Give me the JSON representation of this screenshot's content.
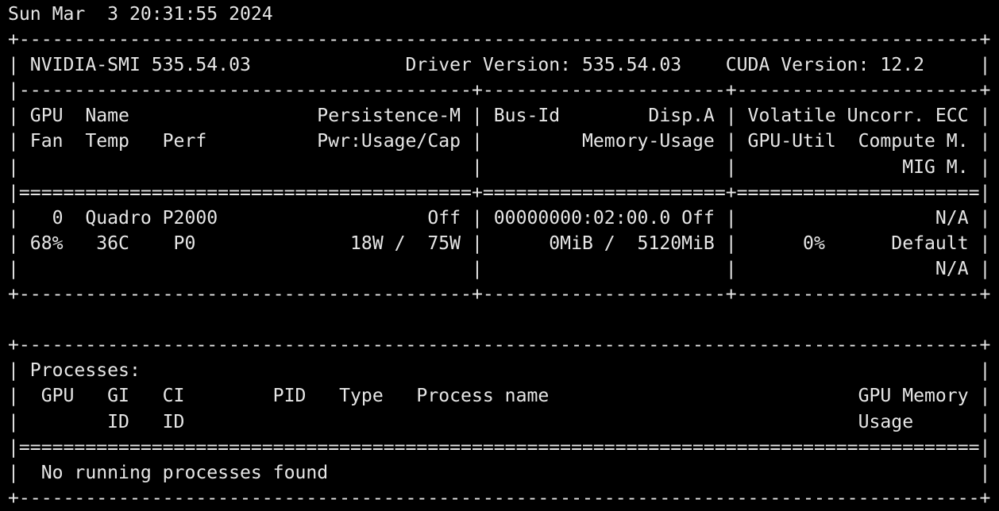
{
  "terminal": {
    "lines": [
      "Sun Mar  3 20:31:55 2024",
      "+---------------------------------------------------------------------------------------+",
      "| NVIDIA-SMI 535.54.03              Driver Version: 535.54.03    CUDA Version: 12.2     |",
      "|-----------------------------------------+----------------------+----------------------+",
      "| GPU  Name                 Persistence-M | Bus-Id        Disp.A | Volatile Uncorr. ECC |",
      "| Fan  Temp   Perf          Pwr:Usage/Cap |         Memory-Usage | GPU-Util  Compute M. |",
      "|                                         |                      |               MIG M. |",
      "|=========================================+======================+======================|",
      "|   0  Quadro P2000                   Off | 00000000:02:00.0 Off |                  N/A |",
      "| 68%   36C    P0              18W /  75W |      0MiB /  5120MiB |      0%      Default |",
      "|                                         |                      |                  N/A |",
      "+-----------------------------------------+----------------------+----------------------+",
      "",
      "+---------------------------------------------------------------------------------------+",
      "| Processes:                                                                            |",
      "|  GPU   GI   CI        PID   Type   Process name                            GPU Memory |",
      "|        ID   ID                                                             Usage      |",
      "|=======================================================================================|",
      "|  No running processes found                                                           |",
      "+---------------------------------------------------------------------------------------+"
    ]
  }
}
